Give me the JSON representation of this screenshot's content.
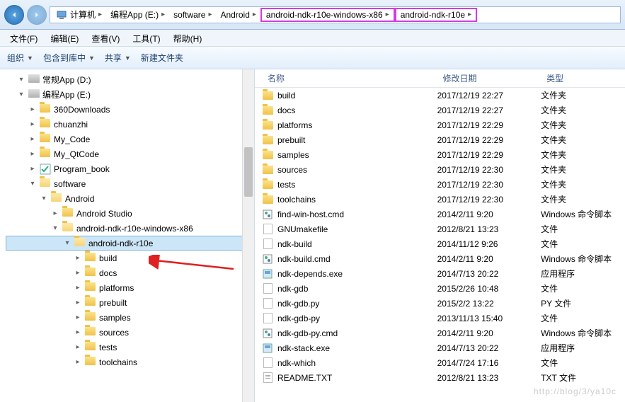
{
  "breadcrumb": [
    {
      "label": "计算机",
      "icon": "pc",
      "hl": false
    },
    {
      "label": "编程App (E:)",
      "hl": false
    },
    {
      "label": "software",
      "hl": false
    },
    {
      "label": "Android",
      "hl": false
    },
    {
      "label": "android-ndk-r10e-windows-x86",
      "hl": true
    },
    {
      "label": "android-ndk-r10e",
      "hl": true
    }
  ],
  "menubar": [
    "文件(F)",
    "编辑(E)",
    "查看(V)",
    "工具(T)",
    "帮助(H)"
  ],
  "toolbar": [
    {
      "label": "组织",
      "dropdown": true
    },
    {
      "label": "包含到库中",
      "dropdown": true
    },
    {
      "label": "共享",
      "dropdown": true
    },
    {
      "label": "新建文件夹",
      "dropdown": false
    }
  ],
  "tree": [
    {
      "label": "常规App (D:)",
      "indent": 1,
      "icon": "disk",
      "expanded": true
    },
    {
      "label": "编程App (E:)",
      "indent": 1,
      "icon": "disk",
      "expanded": true
    },
    {
      "label": "360Downloads",
      "indent": 2,
      "icon": "folder",
      "expanded": false
    },
    {
      "label": "chuanzhi",
      "indent": 2,
      "icon": "folder",
      "expanded": false
    },
    {
      "label": "My_Code",
      "indent": 2,
      "icon": "folder",
      "expanded": false
    },
    {
      "label": "My_QtCode",
      "indent": 2,
      "icon": "folder",
      "expanded": false
    },
    {
      "label": "Program_book",
      "indent": 2,
      "icon": "check",
      "expanded": false
    },
    {
      "label": "software",
      "indent": 2,
      "icon": "folder-open",
      "expanded": true
    },
    {
      "label": "Android",
      "indent": 3,
      "icon": "folder-open",
      "expanded": true
    },
    {
      "label": "Android Studio",
      "indent": 4,
      "icon": "folder",
      "expanded": false
    },
    {
      "label": "android-ndk-r10e-windows-x86",
      "indent": 4,
      "icon": "folder-open",
      "expanded": true
    },
    {
      "label": "android-ndk-r10e",
      "indent": 5,
      "icon": "folder-open",
      "expanded": true,
      "selected": true,
      "arrow": true
    },
    {
      "label": "build",
      "indent": 6,
      "icon": "folder",
      "expanded": false
    },
    {
      "label": "docs",
      "indent": 6,
      "icon": "folder",
      "expanded": false
    },
    {
      "label": "platforms",
      "indent": 6,
      "icon": "folder",
      "expanded": false
    },
    {
      "label": "prebuilt",
      "indent": 6,
      "icon": "folder",
      "expanded": false
    },
    {
      "label": "samples",
      "indent": 6,
      "icon": "folder",
      "expanded": false
    },
    {
      "label": "sources",
      "indent": 6,
      "icon": "folder",
      "expanded": false
    },
    {
      "label": "tests",
      "indent": 6,
      "icon": "folder",
      "expanded": false
    },
    {
      "label": "toolchains",
      "indent": 6,
      "icon": "folder",
      "expanded": false
    }
  ],
  "list_headers": {
    "name": "名称",
    "date": "修改日期",
    "type": "类型"
  },
  "files": [
    {
      "name": "build",
      "date": "2017/12/19 22:27",
      "type": "文件夹",
      "icon": "folder"
    },
    {
      "name": "docs",
      "date": "2017/12/19 22:27",
      "type": "文件夹",
      "icon": "folder"
    },
    {
      "name": "platforms",
      "date": "2017/12/19 22:29",
      "type": "文件夹",
      "icon": "folder"
    },
    {
      "name": "prebuilt",
      "date": "2017/12/19 22:29",
      "type": "文件夹",
      "icon": "folder"
    },
    {
      "name": "samples",
      "date": "2017/12/19 22:29",
      "type": "文件夹",
      "icon": "folder"
    },
    {
      "name": "sources",
      "date": "2017/12/19 22:30",
      "type": "文件夹",
      "icon": "folder"
    },
    {
      "name": "tests",
      "date": "2017/12/19 22:30",
      "type": "文件夹",
      "icon": "folder"
    },
    {
      "name": "toolchains",
      "date": "2017/12/19 22:30",
      "type": "文件夹",
      "icon": "folder"
    },
    {
      "name": "find-win-host.cmd",
      "date": "2014/2/11 9:20",
      "type": "Windows 命令脚本",
      "icon": "cmd"
    },
    {
      "name": "GNUmakefile",
      "date": "2012/8/21 13:23",
      "type": "文件",
      "icon": "file"
    },
    {
      "name": "ndk-build",
      "date": "2014/11/12 9:26",
      "type": "文件",
      "icon": "file"
    },
    {
      "name": "ndk-build.cmd",
      "date": "2014/2/11 9:20",
      "type": "Windows 命令脚本",
      "icon": "cmd"
    },
    {
      "name": "ndk-depends.exe",
      "date": "2014/7/13 20:22",
      "type": "应用程序",
      "icon": "exe"
    },
    {
      "name": "ndk-gdb",
      "date": "2015/2/26 10:48",
      "type": "文件",
      "icon": "file"
    },
    {
      "name": "ndk-gdb.py",
      "date": "2015/2/2 13:22",
      "type": "PY 文件",
      "icon": "file"
    },
    {
      "name": "ndk-gdb-py",
      "date": "2013/11/13 15:40",
      "type": "文件",
      "icon": "file"
    },
    {
      "name": "ndk-gdb-py.cmd",
      "date": "2014/2/11 9:20",
      "type": "Windows 命令脚本",
      "icon": "cmd"
    },
    {
      "name": "ndk-stack.exe",
      "date": "2014/7/13 20:22",
      "type": "应用程序",
      "icon": "exe"
    },
    {
      "name": "ndk-which",
      "date": "2014/7/24 17:16",
      "type": "文件",
      "icon": "file"
    },
    {
      "name": "README.TXT",
      "date": "2012/8/21 13:23",
      "type": "TXT 文件",
      "icon": "txt"
    }
  ],
  "watermark": "http://blog/3/ya10c"
}
